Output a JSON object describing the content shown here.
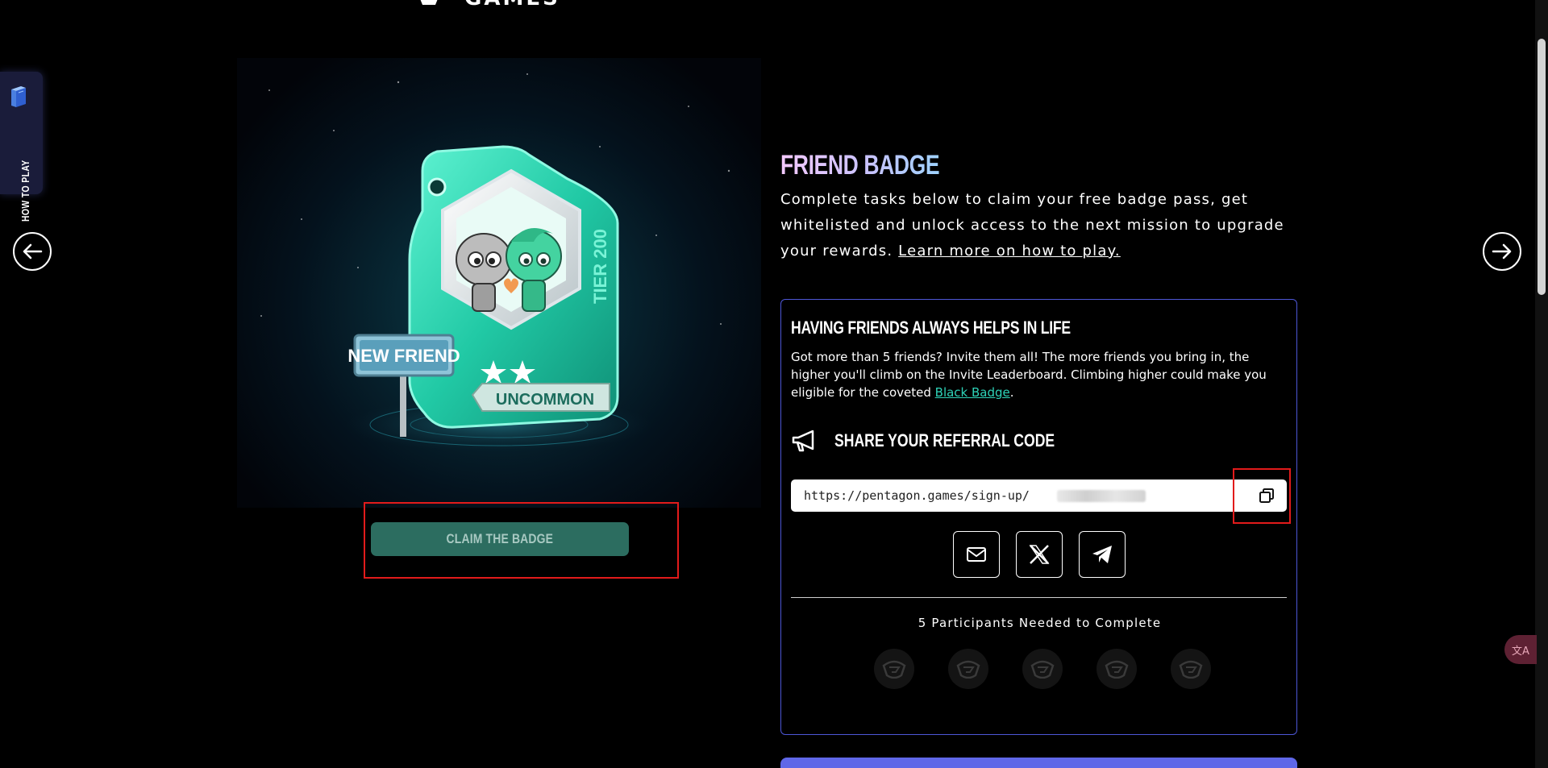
{
  "logo": {
    "wordmark": "GAMES"
  },
  "sidebar_tab": {
    "label": "HOW TO PLAY",
    "icon": "book-icon"
  },
  "nav": {
    "prev_icon": "arrow-left-icon",
    "next_icon": "arrow-right-icon"
  },
  "badge_card": {
    "sign_text": "NEW FRIEND",
    "tier_text": "TIER 200",
    "rarity_text": "UNCOMMON",
    "stars": 2
  },
  "claim_button": {
    "label": "CLAIM THE BADGE"
  },
  "badge_info": {
    "title": "FRIEND BADGE",
    "description": "Complete tasks below to claim your free badge pass, get whitelisted and unlock access to the next mission to upgrade your rewards. ",
    "learn_more_link": "Learn more on how to play."
  },
  "invite_panel": {
    "heading": "HAVING FRIENDS ALWAYS HELPS IN LIFE",
    "text_before_link": "Got more than 5 friends? Invite them all! The more friends you bring in, the higher you'll climb on the Invite Leaderboard. Climbing higher could make you eligible for the coveted ",
    "link_text": "Black Badge",
    "text_after_link": ".",
    "share_title": "SHARE YOUR REFERRAL CODE",
    "referral_value": "https://pentagon.games/sign-up/",
    "share_buttons": [
      "email-icon",
      "x-icon",
      "telegram-icon"
    ],
    "participants_label": "5 Participants Needed to Complete",
    "participants_needed": 5
  },
  "colors": {
    "background": "#000000",
    "accent_teal": "#2ed3b8",
    "claim_button_bg": "#2c6d60",
    "panel_border": "#4d57d6",
    "highlight_red": "#e21b1b"
  }
}
